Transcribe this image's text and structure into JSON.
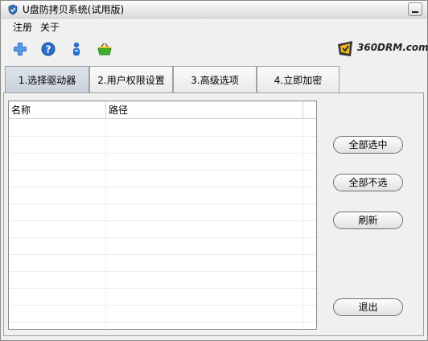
{
  "window": {
    "title": "U盘防拷贝系统(试用版)"
  },
  "menu": {
    "items": [
      "注册",
      "关于"
    ]
  },
  "toolbar": {
    "icons": [
      "add-icon",
      "help-icon",
      "user-icon",
      "basket-icon"
    ]
  },
  "brand": {
    "logo_text": "360DRM.com"
  },
  "tabs": [
    {
      "label": "1.选择驱动器",
      "active": true
    },
    {
      "label": "2.用户权限设置",
      "active": false
    },
    {
      "label": "3.高级选项",
      "active": false
    },
    {
      "label": "4.立即加密",
      "active": false
    }
  ],
  "drive_table": {
    "columns": [
      "名称",
      "路径"
    ],
    "rows": []
  },
  "actions": {
    "select_all": "全部选中",
    "select_none": "全部不选",
    "refresh": "刷新",
    "exit": "退出"
  },
  "colors": {
    "accent": "#2a6fc9",
    "active_tab": "#cfd6de"
  }
}
